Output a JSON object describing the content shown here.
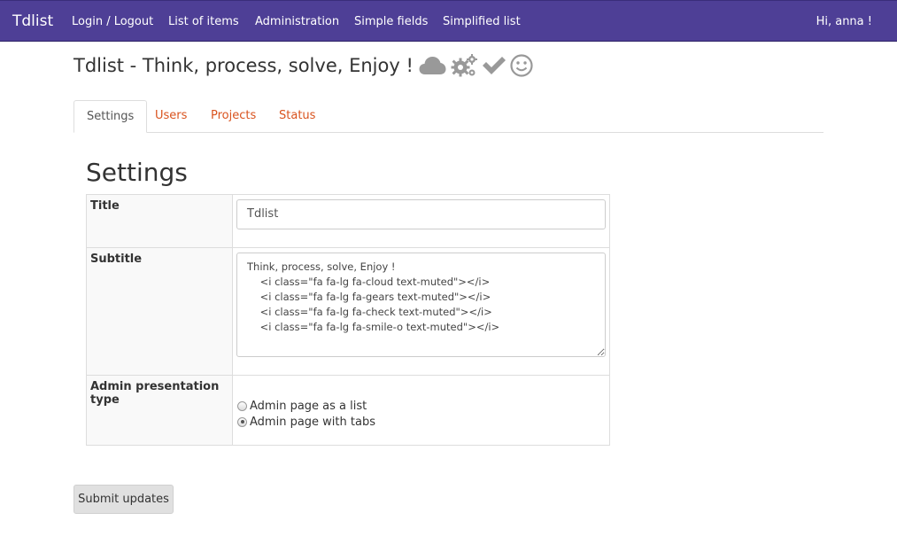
{
  "navbar": {
    "brand": "Tdlist",
    "links": [
      "Login / Logout",
      "List of items",
      "Administration",
      "Simple fields",
      "Simplified list"
    ],
    "user_greeting": "Hi, anna !",
    "background_color": "#4e3f96"
  },
  "page": {
    "title": "Tdlist - Think, process, solve, Enjoy !",
    "title_icons": [
      "cloud-icon",
      "gears-icon",
      "check-icon",
      "smile-icon"
    ],
    "icon_color": "#999999"
  },
  "tabs": [
    {
      "label": "Settings",
      "active": true
    },
    {
      "label": "Users",
      "active": false
    },
    {
      "label": "Projects",
      "active": false
    },
    {
      "label": "Status",
      "active": false
    }
  ],
  "settings": {
    "heading": "Settings",
    "title_label": "Title",
    "title_value": "Tdlist",
    "subtitle_label": "Subtitle",
    "subtitle_value": "Think, process, solve, Enjoy !\n    <i class=\"fa fa-lg fa-cloud text-muted\"></i>\n    <i class=\"fa fa-lg fa-gears text-muted\"></i>\n    <i class=\"fa fa-lg fa-check text-muted\"></i>\n    <i class=\"fa fa-lg fa-smile-o text-muted\"></i>",
    "admin_label": "Admin presentation type",
    "admin_options": [
      {
        "label": "Admin page as a list",
        "checked": false
      },
      {
        "label": "Admin page with tabs",
        "checked": true
      }
    ]
  },
  "submit_label": "Submit updates",
  "colors": {
    "tab_link": "#d9531e",
    "button_bg": "#e0e0e0"
  }
}
